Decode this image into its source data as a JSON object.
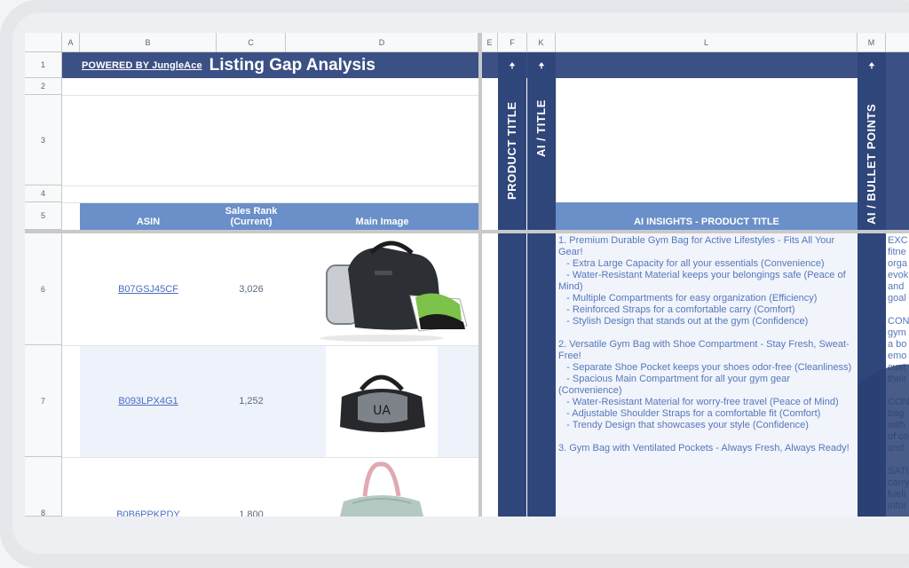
{
  "columns": [
    "A",
    "B",
    "C",
    "D",
    "E",
    "F",
    "K",
    "L",
    "M"
  ],
  "rows": [
    "1",
    "2",
    "3",
    "4",
    "5",
    "6",
    "7",
    "8"
  ],
  "header": {
    "powered_by": "POWERED BY JungleAce",
    "title": "Listing Gap Analysis"
  },
  "table_headers": {
    "asin": "ASIN",
    "sales_rank": "Sales Rank\n(Current)",
    "main_image": "Main Image",
    "product_title": "PRODUCT TITLE",
    "ai_title": "AI / TITLE",
    "ai_insights": "AI INSIGHTS - PRODUCT TITLE",
    "ai_bullets": "AI / BULLET POINTS"
  },
  "arrow_glyph": "🠉",
  "products": [
    {
      "asin": "B07GSJ45CF",
      "rank": "3,026",
      "image": "black-gym-bag-with-shoe-pocket"
    },
    {
      "asin": "B093LPX4G1",
      "rank": "1,252",
      "image": "black-grey-duffel-bag"
    },
    {
      "asin": "B0B6PPKPDY",
      "rank": "1,800",
      "image": "mint-duffel-bag-pink-handles"
    }
  ],
  "insights_text": "1. Premium Durable Gym Bag for Active Lifestyles - Fits All Your Gear!\n   - Extra Large Capacity for all your essentials (Convenience)\n   - Water-Resistant Material keeps your belongings safe (Peace of Mind)\n   - Multiple Compartments for easy organization (Efficiency)\n   - Reinforced Straps for a comfortable carry (Comfort)\n   - Stylish Design that stands out at the gym (Confidence)\n\n2. Versatile Gym Bag with Shoe Compartment - Stay Fresh, Sweat-Free!\n   - Separate Shoe Pocket keeps your shoes odor-free (Cleanliness)\n   - Spacious Main Compartment for all your gym gear (Convenience)\n   - Water-Resistant Material for worry-free travel (Peace of Mind)\n   - Adjustable Shoulder Straps for a comfortable fit (Comfort)\n   - Trendy Design that showcases your style (Confidence)\n\n3. Gym Bag with Ventilated Pockets - Always Fresh, Always Ready!",
  "bullets_text": "EXC\nfitne\norga\nevok\nand\ngoal\n\nCON\ngym\na bo\nemo\ncust\ntheir\n\nCON\nbag\nwith\nof co\nand\n\nSATI\ncarry\nfueli\ninfor",
  "colors": {
    "header_dark": "#3b5084",
    "header_light": "#6a8fc9",
    "link": "#4a6cc0"
  }
}
